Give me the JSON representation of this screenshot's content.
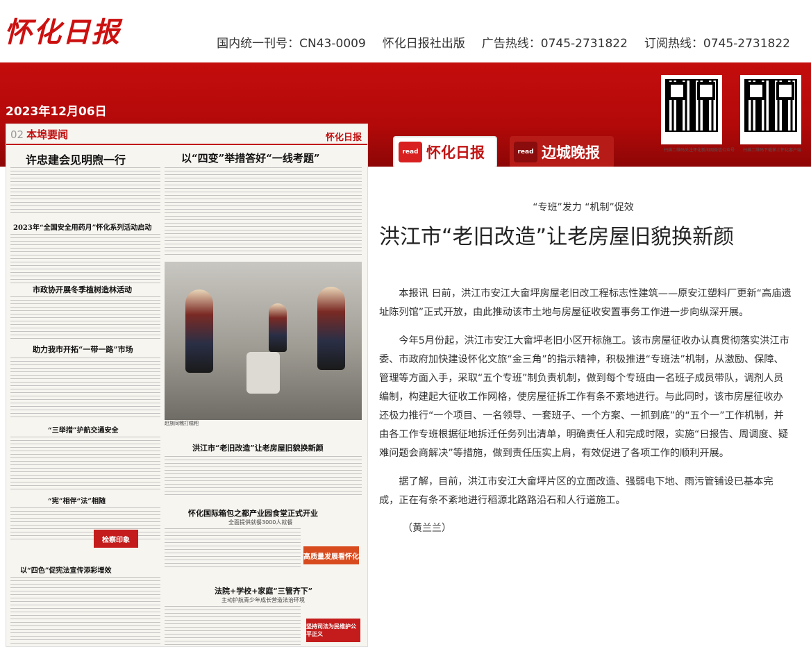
{
  "header": {
    "logo": "怀化日报",
    "issn": "国内统一刊号：CN43-0009",
    "publisher": "怀化日报社出版",
    "ad_line": "广告热线：0745-2731822",
    "sub_line": "订阅热线：0745-2731822"
  },
  "date": "2023年12月06日",
  "qr_codes": [
    {
      "caption": "扫描二维码关注怀化新闻网微信公众号"
    },
    {
      "caption": "扫描二维码下载掌上怀化客户端"
    }
  ],
  "tabs": [
    {
      "badge": "read",
      "label": "怀化日报"
    },
    {
      "badge": "read",
      "label": "边城晚报"
    }
  ],
  "paper": {
    "section_no": "02",
    "section": "本埠要闻",
    "masthead": "怀化日报",
    "headlines": {
      "h1": "许忠建会见明煦一行",
      "h2": "以“四变”举措答好“一线考题”",
      "h3": "2023年“全国安全用药月”怀化系列活动启动",
      "h4": "市政协开展冬季植树造林活动",
      "h5": "助力我市开拓“一带一路”市场",
      "h6": "“三举措”护航交通安全",
      "h7": "洪江市“老旧改造”让老房屋旧貌换新颜",
      "h8": "“宪”相伴“法”相随",
      "h9": "怀化国际箱包之都产业园食堂正式开业",
      "h9_sub": "全面提供就餐3000人就餐",
      "h10": "以“四色”促宪法宣传添彩增效",
      "h11": "法院+学校+家庭“三管齐下”",
      "h11_sub": "主动护航青少年成长营造法治环境"
    },
    "photo_caption": "赶族同糯打糍粑",
    "stamp1": "检察印象",
    "stamp2": "高质量发展看怀化",
    "stamp3": "坚持司法为民维护公平正义"
  },
  "article": {
    "kicker": "“专班”发力 “机制”促效",
    "title": "洪江市“老旧改造”让老房屋旧貌换新颜",
    "paragraphs": [
      "本报讯 日前，洪江市安江大畲坪房屋老旧改工程标志性建筑——原安江塑料厂更新“高庙遗址陈列馆”正式开放，由此推动该市土地与房屋征收安置事务工作进一步向纵深开展。",
      "今年5月份起，洪江市安江大畲坪老旧小区开标施工。该市房屋征收办认真贯彻落实洪江市委、市政府加快建设怀化文旅“金三角”的指示精神，积极推进“专班法”机制，从激励、保障、管理等方面入手，采取“五个专班”制负责机制，做到每个专班由一名班子成员带队，调剂人员编制，构建起大征收工作网格，使房屋征拆工作有条不紊地进行。与此同时，该市房屋征收办还极力推行“一个项目、一名领导、一套班子、一个方案、一抓到底”的“五个一”工作机制，并由各工作专班根据征地拆迁任务列出清单，明确责任人和完成时限，实施“日报告、周调度、疑难问题会商解决”等措施，做到责任压实上肩，有效促进了各项工作的顺利开展。",
      "据了解，目前，洪江市安江大畲坪片区的立面改造、强弱电下地、雨污管铺设已基本完成，正在有条不紊地进行稻源北路路沿石和人行道施工。"
    ],
    "author": "（黄兰兰）"
  },
  "colors": {
    "brand_red": "#c40d0d",
    "text": "#333333"
  }
}
